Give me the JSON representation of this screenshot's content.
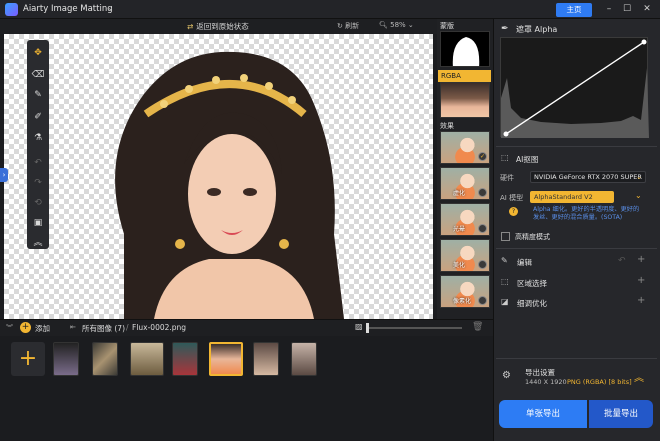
{
  "app": {
    "title": "Aiarty Image Matting",
    "home_label": "主页"
  },
  "toolbar": {
    "revert_label": "返回到原始状态",
    "refresh_label": "刷新",
    "zoom": "58%"
  },
  "layers": {
    "mask_label": "蒙版",
    "rgba_label": "RGBA",
    "effects_label": "效果",
    "effects": [
      "",
      "虚化",
      "光晕",
      "美化",
      "像素化"
    ]
  },
  "alpha": {
    "title": "遮罩 Alpha"
  },
  "ai": {
    "section_title": "AI抠图",
    "hardware_label": "硬件",
    "hardware_value": "NVIDIA GeForce RTX 2070 SUPER",
    "model_label": "AI 模型",
    "model_value": "AlphaStandard  V2",
    "hint": "Alpha 细化。更好的半透明度、更好的发丝、更好的混合质量。(SOTA)",
    "high_precision_label": "高精度模式"
  },
  "sections": {
    "edit": "编辑",
    "region": "区域选择",
    "refine": "细调优化"
  },
  "export": {
    "settings_label": "导出设置",
    "info": "1440 X 1920",
    "format": "PNG (RGBA) [8 bits]",
    "single_label": "单张导出",
    "batch_label": "批量导出"
  },
  "film": {
    "add_label": "添加",
    "all_images": "所有图像 (7)",
    "filename": "Flux-0002.png",
    "thumb_count": 7,
    "selected_index": 4
  }
}
